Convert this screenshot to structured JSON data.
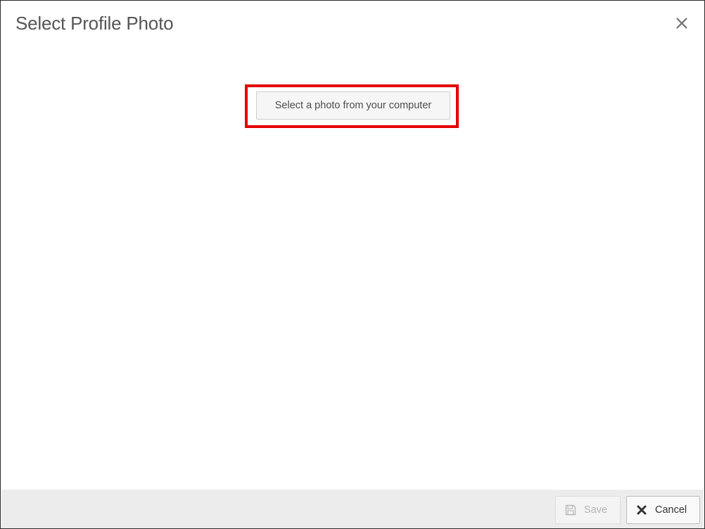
{
  "dialog": {
    "title": "Select Profile Photo",
    "close_icon": "close-icon"
  },
  "main": {
    "select_photo_label": "Select a photo from your computer"
  },
  "footer": {
    "save_label": "Save",
    "save_icon": "floppy-disk-icon",
    "cancel_label": "Cancel",
    "cancel_icon": "x-icon"
  },
  "colors": {
    "highlight": "#e60000",
    "footer_bg": "#ececec",
    "title_text": "#555555"
  }
}
